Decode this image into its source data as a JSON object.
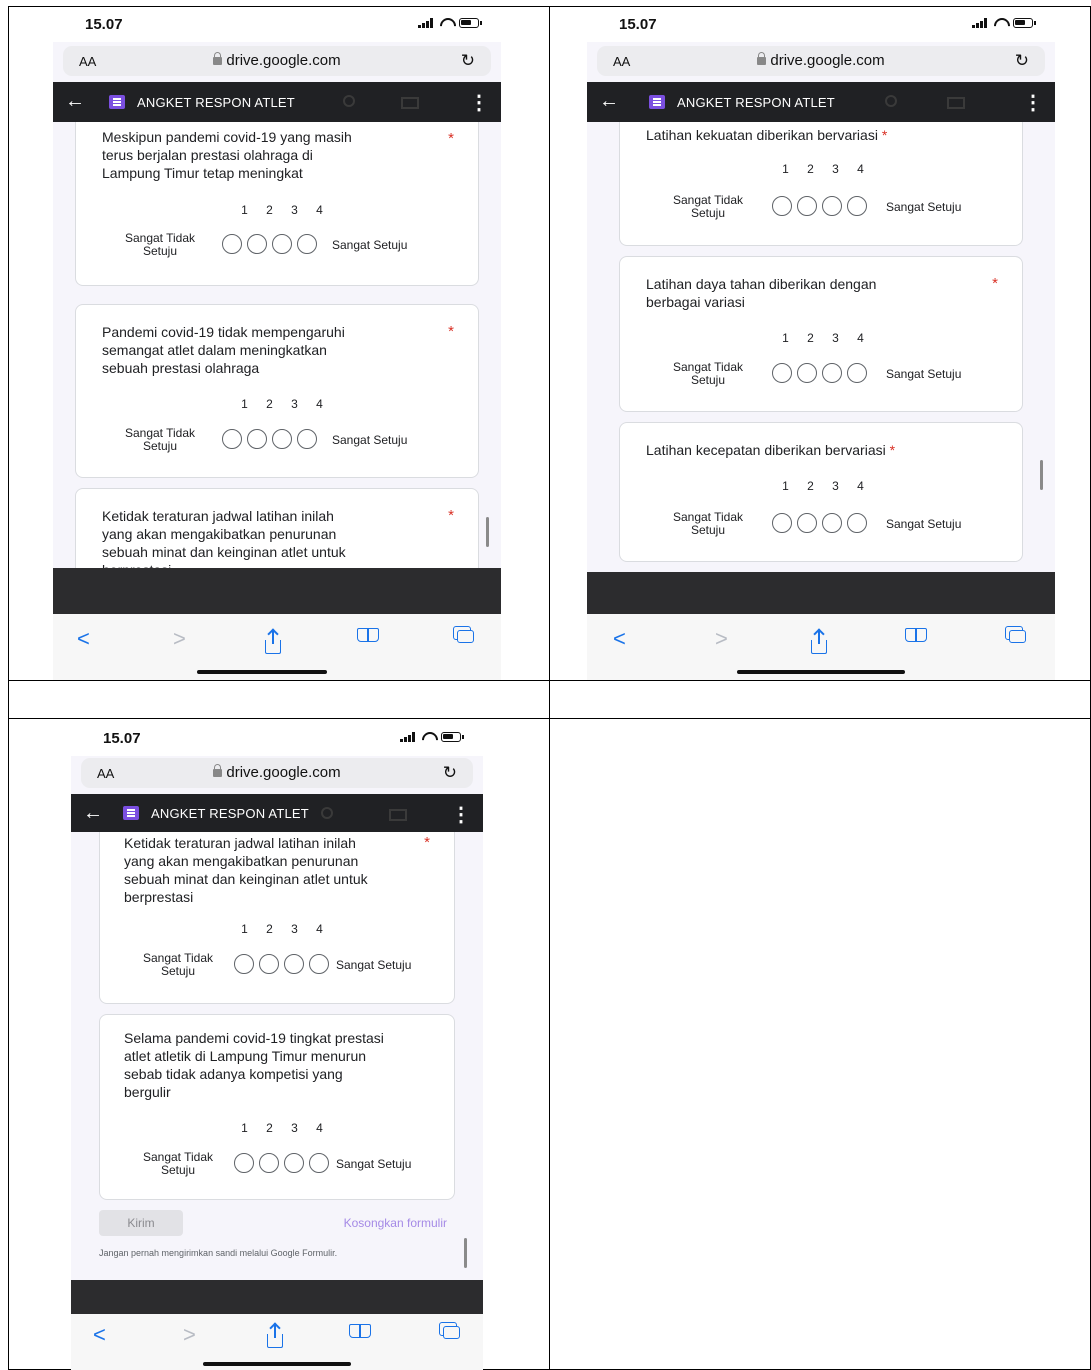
{
  "status_bar": {
    "time": "15.07"
  },
  "url_bar": {
    "aa_label": "AA",
    "domain": "drive.google.com"
  },
  "app_bar": {
    "title": "ANGKET RESPON ATLET"
  },
  "scale": {
    "numbers": [
      "1",
      "2",
      "3",
      "4"
    ],
    "low_label_1": "Sangat Tidak",
    "low_label_2": "Setuju",
    "high_label": "Sangat Setuju"
  },
  "required_mark": "*",
  "screen1": {
    "q1": {
      "lines": [
        "Meskipun pandemi covid-19 yang masih",
        "terus berjalan prestasi olahraga di",
        "Lampung Timur tetap meningkat"
      ]
    },
    "q2": {
      "lines": [
        "Pandemi covid-19 tidak mempengaruhi",
        "semangat atlet dalam meningkatkan",
        "sebuah prestasi olahraga"
      ]
    },
    "q3": {
      "lines": [
        "Ketidak teraturan jadwal latihan inilah",
        "yang akan mengakibatkan penurunan",
        "sebuah minat dan keinginan atlet untuk",
        "berprestasi"
      ]
    }
  },
  "screen2": {
    "q1": {
      "lines": [
        "Latihan kekuatan diberikan bervariasi"
      ]
    },
    "q2": {
      "lines": [
        "Latihan daya tahan diberikan dengan",
        "berbagai variasi"
      ]
    },
    "q3": {
      "lines": [
        "Latihan kecepatan diberikan bervariasi"
      ]
    }
  },
  "screen3": {
    "q1": {
      "lines": [
        "Ketidak teraturan jadwal latihan inilah",
        "yang akan mengakibatkan penurunan",
        "sebuah minat dan keinginan atlet untuk",
        "berprestasi"
      ]
    },
    "q2": {
      "lines": [
        "Selama pandemi covid-19 tingkat prestasi",
        "atlet atletik di Lampung Timur menurun",
        "sebab tidak adanya kompetisi yang",
        "bergulir"
      ]
    },
    "submit_label": "Kirim",
    "clear_label": "Kosongkan formulir",
    "disclaimer": "Jangan pernah mengirimkan sandi melalui Google Formulir."
  },
  "nav": {
    "back": "<",
    "forward": ">"
  },
  "colors": {
    "app_bar_bg": "#202124",
    "accent": "#7b4fe0",
    "required": "#d93025",
    "link": "#1a73e8"
  }
}
